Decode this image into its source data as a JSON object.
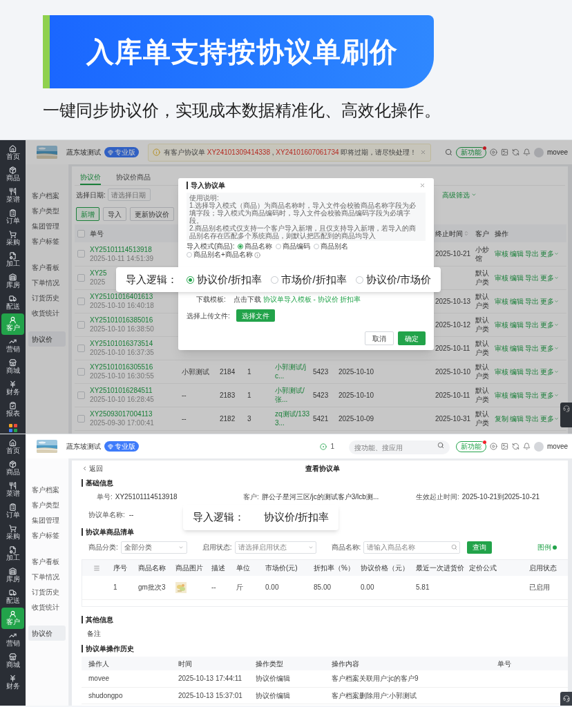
{
  "banner": {
    "title": "入库单支持按协议单刷价",
    "subtitle": "一键同步协议价，实现成本数据精准化、高效化操作。"
  },
  "list_screen": {
    "nav": [
      {
        "label": "首页",
        "selected": false
      },
      {
        "label": "商品",
        "selected": false
      },
      {
        "label": "菜谱",
        "selected": false
      },
      {
        "label": "订单",
        "selected": false
      },
      {
        "label": "采购",
        "selected": false
      },
      {
        "label": "加工",
        "selected": false
      },
      {
        "label": "库房",
        "selected": false
      },
      {
        "label": "配送",
        "selected": false
      },
      {
        "label": "客户",
        "selected": true
      },
      {
        "label": "营销",
        "selected": false
      },
      {
        "label": "商城",
        "selected": false
      },
      {
        "label": "财务",
        "selected": false
      },
      {
        "label": "报表",
        "selected": false
      }
    ],
    "company": "蔬东坡测试",
    "edition": "专业版",
    "notice": {
      "prefix": "有客户协议单",
      "codes": [
        "XY24101309414338",
        "XY24101607061734"
      ],
      "separator": " , ",
      "suffix": "即将过期，请尽快处理！"
    },
    "new_feature": "新功能",
    "user": "movee",
    "subnav": [
      {
        "items": [
          {
            "label": "客户档案",
            "selected": false
          },
          {
            "label": "客户类型",
            "selected": false
          },
          {
            "label": "集团管理",
            "selected": false
          },
          {
            "label": "客户标签",
            "selected": false
          }
        ]
      },
      {
        "items": [
          {
            "label": "客户看板",
            "selected": false
          },
          {
            "label": "下单情况",
            "selected": false
          },
          {
            "label": "订货历史",
            "selected": false
          },
          {
            "label": "收货统计",
            "selected": false
          }
        ]
      },
      {
        "items": [
          {
            "label": "协议价",
            "selected": true
          }
        ]
      }
    ],
    "tabs": [
      {
        "label": "协议价",
        "selected": true
      },
      {
        "label": "协议价商品",
        "selected": false
      }
    ],
    "date_filter": {
      "label": "选择日期:",
      "placeholder": "请选择日期"
    },
    "advanced_filter": "高级筛选",
    "buttons": [
      {
        "label": "新增",
        "kind": "primary"
      },
      {
        "label": "导入",
        "kind": "default"
      },
      {
        "label": "更新协议价",
        "kind": "default"
      }
    ],
    "table": {
      "header_checked": false,
      "columns": {
        "order": "单号",
        "end": "终止时间",
        "customer": "客户",
        "actions": "操作"
      },
      "rows": [
        {
          "checked": false,
          "order": "XY25101114513918",
          "created": "2025-10-11 14:51:39",
          "end": "2025-10-21",
          "customer": "小炒馆",
          "actions": [
            "审核",
            "编辑",
            "导出",
            "更多"
          ]
        },
        {
          "checked": false,
          "order": "XY25",
          "created": "2025",
          "customer": "默认户类",
          "actions": [
            "审核",
            "编辑",
            "导出",
            "更多"
          ]
        },
        {
          "checked": false,
          "order": "XY25101016401613",
          "created": "2025-10-10 16:40:18",
          "end": "2025-10-13",
          "customer": "默认户类",
          "actions": [
            "审核",
            "编辑",
            "导出",
            "更多"
          ]
        },
        {
          "checked": false,
          "order": "XY25101016385016",
          "created": "2025-10-10 16:38:50",
          "end": "2025-10-12",
          "customer": "默认户类",
          "actions": [
            "审核",
            "编辑",
            "导出",
            "更多"
          ]
        },
        {
          "checked": false,
          "order": "XY25101016373514",
          "created": "2025-10-10 16:37:35",
          "end": "2025-10-11",
          "customer": "默认户类",
          "actions": [
            "审核",
            "编辑",
            "导出",
            "更多"
          ]
        },
        {
          "checked": false,
          "order": "XY25101016305516",
          "created": "2025-10-10 16:30:55",
          "column_3": "小郭测试",
          "column_4": "2184",
          "column_5": "1",
          "column_6": "小郭测试/jc...",
          "column_7": "5423",
          "column_8": "2025-10-10",
          "end": "2025-10-10",
          "customer": "默认户类",
          "actions": [
            "审核",
            "编辑",
            "导出",
            "更多"
          ]
        },
        {
          "checked": false,
          "order": "XY25101016284511",
          "created": "2025-10-10 16:28:45",
          "column_3": "--",
          "column_4": "2183",
          "column_5": "1",
          "column_6": "小郭测试/张...",
          "column_7": "5423",
          "column_8": "2025-10-10",
          "end": "2025-10-11",
          "customer": "默认户类",
          "actions": [
            "审核",
            "编辑",
            "导出",
            "更多"
          ]
        },
        {
          "checked": false,
          "order": "XY25093017004113",
          "created": "2025-09-30 17:00:41",
          "column_3": "--",
          "column_4": "2182",
          "column_5": "3",
          "column_6": "zq测试/1333...",
          "column_7": "5421",
          "column_8": "2025-10-09",
          "end": "2025-10-31",
          "customer": "默认户类",
          "actions": [
            "复制",
            "编辑",
            "导出",
            "更多"
          ]
        }
      ]
    },
    "modal": {
      "title": "导入协议单",
      "instructions": [
        "使用说明:",
        "1.选择导入模式（商品）为商品名称时，导入文件会校验商品名称字段为必填字段；导入模式为商品编码时，导入文件会校验商品编码字段为必填字段。",
        "2.商品别名模式仅支持一个客户导入新增，且仅支持导入新增，若导入的商品别名存在匹配多个系统商品，则默认把匹配到的商品均导入"
      ],
      "mode_label": "导入模式(商品):",
      "modes": [
        {
          "label": "商品名称",
          "selected": true
        },
        {
          "label": "商品编码",
          "selected": false
        },
        {
          "label": "商品别名",
          "selected": false
        },
        {
          "label": "商品别名+商品名称",
          "selected": false
        }
      ],
      "template_label": "下载模板:",
      "template_prefix": "点击下载",
      "template_link": "协议单导入模板 - 协议价 折扣率",
      "upload_label": "选择上传文件:",
      "upload_button": "选择文件",
      "cancel": "取消",
      "confirm": "确定"
    },
    "callout": {
      "label": "导入逻辑：",
      "options": [
        {
          "label": "协议价/折扣率",
          "selected": true
        },
        {
          "label": "市场价/折扣率",
          "selected": false
        },
        {
          "label": "协议价/市场价",
          "selected": false
        }
      ]
    }
  },
  "detail_screen": {
    "nav": [
      {
        "label": "首页",
        "selected": false
      },
      {
        "label": "商品",
        "selected": false
      },
      {
        "label": "菜谱",
        "selected": false
      },
      {
        "label": "订单",
        "selected": false
      },
      {
        "label": "采购",
        "selected": false
      },
      {
        "label": "加工",
        "selected": false
      },
      {
        "label": "库房",
        "selected": false
      },
      {
        "label": "配送",
        "selected": false
      },
      {
        "label": "客户",
        "selected": true
      },
      {
        "label": "营销",
        "selected": false
      },
      {
        "label": "商城",
        "selected": false
      },
      {
        "label": "财务",
        "selected": false
      }
    ],
    "company": "蔬东坡测试",
    "edition": "专业版",
    "count": "1",
    "search_placeholder": "搜功能、搜应用",
    "new_feature": "新功能",
    "user": "movee",
    "subnav": [
      {
        "items": [
          {
            "label": "客户档案",
            "selected": false
          },
          {
            "label": "客户类型",
            "selected": false
          },
          {
            "label": "集团管理",
            "selected": false
          },
          {
            "label": "客户标签",
            "selected": false
          }
        ]
      },
      {
        "items": [
          {
            "label": "客户看板",
            "selected": false
          },
          {
            "label": "下单情况",
            "selected": false
          },
          {
            "label": "订货历史",
            "selected": false
          },
          {
            "label": "收货统计",
            "selected": false
          }
        ]
      },
      {
        "items": [
          {
            "label": "协议价",
            "selected": true
          }
        ]
      }
    ],
    "back": "返回",
    "title": "查看协议单",
    "basic_title": "基础信息",
    "basic": [
      {
        "label": "单号:",
        "value": "XY25101114513918"
      },
      {
        "label": "客户:",
        "value": "胖公子星河三区/jc的测试客户3/lcb测..."
      },
      {
        "label": "生效起止时间:",
        "value": "2025-10-21到2025-10-21"
      }
    ],
    "name_field": {
      "label": "协议单名称:",
      "value": "--"
    },
    "list_title": "协议单商品清单",
    "filters": [
      {
        "kind": "select",
        "label": "商品分类:",
        "value": "全部分类"
      },
      {
        "kind": "select",
        "label": "启用状态:",
        "placeholder": "请选择启用状态"
      },
      {
        "kind": "search",
        "label": "商品名称:",
        "placeholder": "请输入商品名称"
      }
    ],
    "query": "查询",
    "legend": "图例",
    "product_columns": [
      "序号",
      "商品名称",
      "商品图片",
      "描述",
      "单位",
      "市场价(元)",
      "折扣率（%）",
      "协议价格（元）",
      "最近一次进货价",
      "定价公式",
      "启用状态"
    ],
    "products": [
      {
        "index": "1",
        "name": "gm批次3",
        "description": "--",
        "unit": "斤",
        "market_price": "0.00",
        "discount": "85.00",
        "price": "0.00",
        "last_purchase": "5.81",
        "status": "已启用"
      }
    ],
    "other_title": "其他信息",
    "remark_label": "备注",
    "history_title": "协议单操作历史",
    "history_columns": [
      "操作人",
      "时间",
      "操作类型",
      "操作内容",
      "单号"
    ],
    "history": [
      {
        "operator": "movee",
        "time": "2025-10-13 17:44:11",
        "type": "协议价编辑",
        "content": "客户档案关联用户:jc的客户9"
      },
      {
        "operator": "shudongpo",
        "time": "2025-10-13 15:37:01",
        "type": "协议价编辑",
        "content": "客户档案删除用户:小郭测试"
      }
    ],
    "callout": {
      "label": "导入逻辑：",
      "value": "协议价/折扣率"
    }
  }
}
